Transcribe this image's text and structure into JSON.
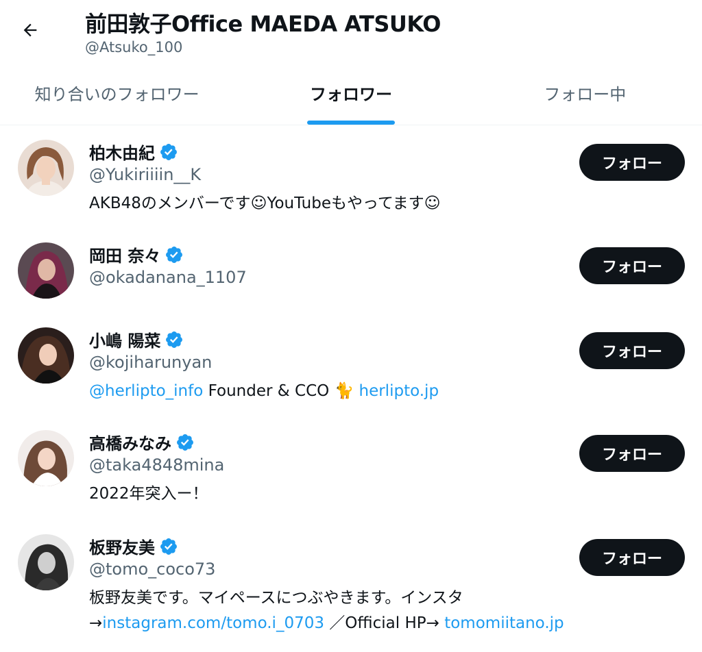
{
  "header": {
    "back_icon": "arrow-left-icon",
    "title": "前田敦子Office MAEDA ATSUKO",
    "handle": "@Atsuko_100"
  },
  "tabs": [
    {
      "label": "知り合いのフォロワー",
      "active": false
    },
    {
      "label": "フォロワー",
      "active": true
    },
    {
      "label": "フォロー中",
      "active": false
    }
  ],
  "colors": {
    "accent": "#1d9bf0",
    "text_primary": "#0f1419",
    "text_secondary": "#536471",
    "button_bg": "#0f1419"
  },
  "users": [
    {
      "name": "柏木由紀",
      "verified": true,
      "handle": "@Yukiriiiin__K",
      "follow_label": "フォロー",
      "bio": {
        "text1": "AKB48のメンバーです☺YouTubeもやってます☺"
      }
    },
    {
      "name": "岡田 奈々",
      "verified": true,
      "handle": "@okadanana_1107",
      "follow_label": "フォロー"
    },
    {
      "name": "小嶋 陽菜",
      "verified": true,
      "handle": "@kojiharunyan",
      "follow_label": "フォロー",
      "bio": {
        "link1": "@herlipto_info",
        "text1": " Founder & CCO 🐈 ",
        "link2": "herlipto.jp"
      }
    },
    {
      "name": "高橋みなみ",
      "verified": true,
      "handle": "@taka4848mina",
      "follow_label": "フォロー",
      "bio": {
        "text1": "2022年突入ー！"
      }
    },
    {
      "name": "板野友美",
      "verified": true,
      "handle": "@tomo_coco73",
      "follow_label": "フォロー",
      "bio": {
        "line1": "板野友美です。マイペースにつぶやきます。インスタ",
        "arrow1": "→",
        "link1": "instagram.com/tomo.i_0703",
        "text2": " ／Official HP→ ",
        "link2": "tomomiitano.jp"
      }
    }
  ]
}
